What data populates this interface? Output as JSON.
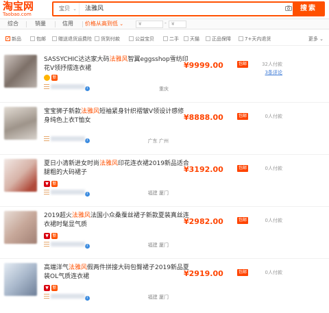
{
  "header": {
    "logo_main": "淘宝网",
    "logo_sub": "Taobao.com",
    "search_category": "宝贝",
    "search_query": "法雅风",
    "search_button": "搜索"
  },
  "sortbar": {
    "tabs": [
      "综合",
      "销量",
      "信用",
      "价格从高到低"
    ],
    "price_min_placeholder": "¥",
    "price_max_placeholder": "¥"
  },
  "filters": {
    "items": [
      "新品",
      "包邮",
      "赠送退货运费险",
      "货到付款",
      "公益宝贝",
      "二手",
      "天猫",
      "正品保障",
      "7+天内退货"
    ],
    "more": "更多"
  },
  "products": [
    {
      "title_before": "SASSYCHIC达达家大码",
      "keyword": "法雅风",
      "title_after": "智翼eggsshop雪纺印花V领抒摆连衣裙",
      "price": "¥9999.00",
      "free_shipping": "包邮",
      "pay_count": "32人付款",
      "reviews": "3条评论",
      "location": "重庆"
    },
    {
      "title_before": "宝宝狮子新款",
      "keyword": "法雅风",
      "title_after": "短袖紧身针织褶皱V领设计感修身纯色上衣T恤女",
      "price": "¥8888.00",
      "free_shipping": "包邮",
      "pay_count": "0人付款",
      "reviews": "",
      "location": "广东 广州"
    },
    {
      "title_before": "夏日小清新进女时尚",
      "keyword": "法雅风",
      "title_after": "印花连衣裙2019新品适合腿粗的大码裙子",
      "price": "¥3192.00",
      "free_shipping": "包邮",
      "pay_count": "0人付款",
      "reviews": "",
      "location": "福建 厦门"
    },
    {
      "title_before": "2019超火",
      "keyword": "法雅风",
      "title_after": "法国小众桑蚕丝裙子新款夏装真丝连衣裙时髦显气质",
      "price": "¥2982.00",
      "free_shipping": "包邮",
      "pay_count": "0人付款",
      "reviews": "",
      "location": "福建 厦门"
    },
    {
      "title_before": "高端洋气",
      "keyword": "法雅风",
      "title_after": "假两件拼接大码包臀裙子2019新品夏装OL气质连衣裙",
      "price": "¥2919.00",
      "free_shipping": "包邮",
      "pay_count": "0人付款",
      "reviews": "",
      "location": "福建 厦门"
    }
  ],
  "colors": {
    "accent": "#ff5000",
    "price": "#ff4400"
  }
}
